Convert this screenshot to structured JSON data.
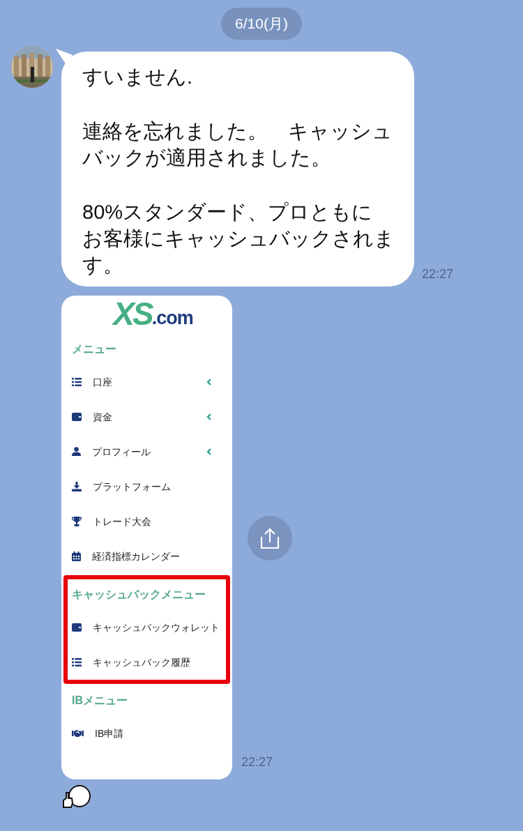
{
  "date": "6/10(月)",
  "messages": [
    {
      "kind": "text",
      "time": "22:27",
      "paragraphs": [
        [
          "すいません."
        ],
        [
          "連絡を忘れました。　キャッシュ",
          "バックが適用されました。"
        ],
        [
          "80%スタンダード、プロともに",
          "お客様にキャッシュバックされま",
          "す。"
        ]
      ]
    },
    {
      "time": "22:27",
      "screenshot": {
        "logo_main": "XS",
        "logo_suffix": ".com",
        "sections": [
          {
            "heading": "メニュー",
            "highlighted": false,
            "items": [
              {
                "label": "口座",
                "expandable": true
              },
              {
                "label": "資金",
                "expandable": true
              },
              {
                "label": "プロフィール",
                "expandable": true
              },
              {
                "label": "プラットフォーム",
                "expandable": false
              },
              {
                "label": "トレード大会",
                "expandable": false
              },
              {
                "label": "経済指標カレンダー",
                "expandable": false
              }
            ]
          },
          {
            "heading": "キャッシュバックメニュー",
            "highlighted": true,
            "items": [
              {
                "label": "キャッシュバックウォレット",
                "expandable": false
              },
              {
                "label": "キャッシュバック履歴",
                "expandable": false
              }
            ]
          },
          {
            "heading": "IBメニュー",
            "highlighted": false,
            "items": [
              {
                "label": "IB申請",
                "expandable": false
              }
            ]
          }
        ]
      }
    },
    {
      "kind": "sticker"
    }
  ]
}
